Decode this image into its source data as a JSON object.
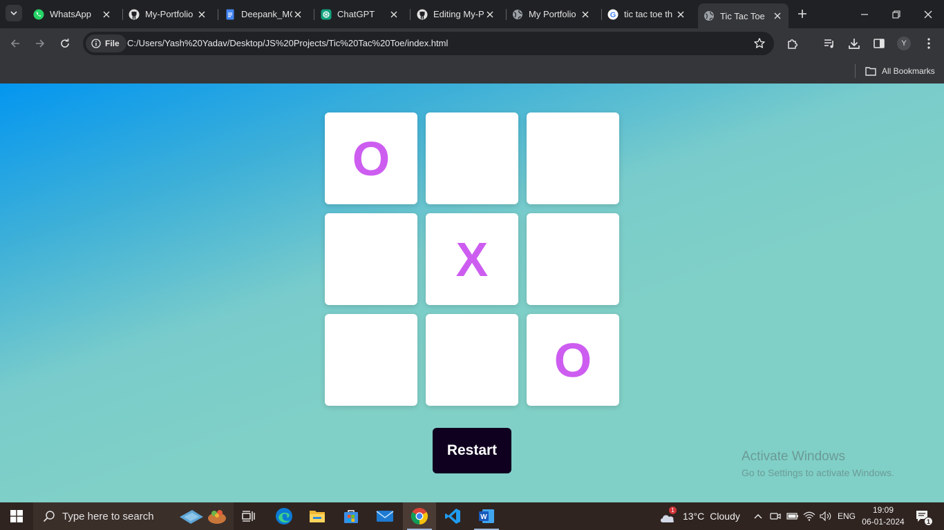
{
  "browser": {
    "tabs": [
      {
        "label": "WhatsApp",
        "icon": "whatsapp-icon"
      },
      {
        "label": "My-Portfolio",
        "icon": "github-icon"
      },
      {
        "label": "Deepank_MC",
        "icon": "google-docs-icon"
      },
      {
        "label": "ChatGPT",
        "icon": "chatgpt-icon"
      },
      {
        "label": "Editing My-P",
        "icon": "github-icon"
      },
      {
        "label": "My Portfolio",
        "icon": "globe-icon"
      },
      {
        "label": "tic tac toe th",
        "icon": "google-icon"
      },
      {
        "label": "Tic Tac Toe",
        "icon": "globe-icon"
      }
    ],
    "active_tab": 7,
    "address": {
      "chip_label": "File",
      "url": "C:/Users/Yash%20Yadav/Desktop/JS%20Projects/Tic%20Tac%20Toe/index.html"
    },
    "profile_initial": "Y",
    "bookmarks_label": "All Bookmarks"
  },
  "game": {
    "cells": [
      "O",
      "",
      "",
      "",
      "X",
      "",
      "",
      "",
      "O"
    ],
    "restart_label": "Restart",
    "mark_color": "#cd5df0"
  },
  "watermark": {
    "line1": "Activate Windows",
    "line2": "Go to Settings to activate Windows."
  },
  "taskbar": {
    "search_placeholder": "Type here to search",
    "weather": {
      "temp": "13°C",
      "condition": "Cloudy",
      "badge": "1"
    },
    "language": "ENG",
    "time": "19:09",
    "date": "06-01-2024",
    "notifications": "1"
  }
}
